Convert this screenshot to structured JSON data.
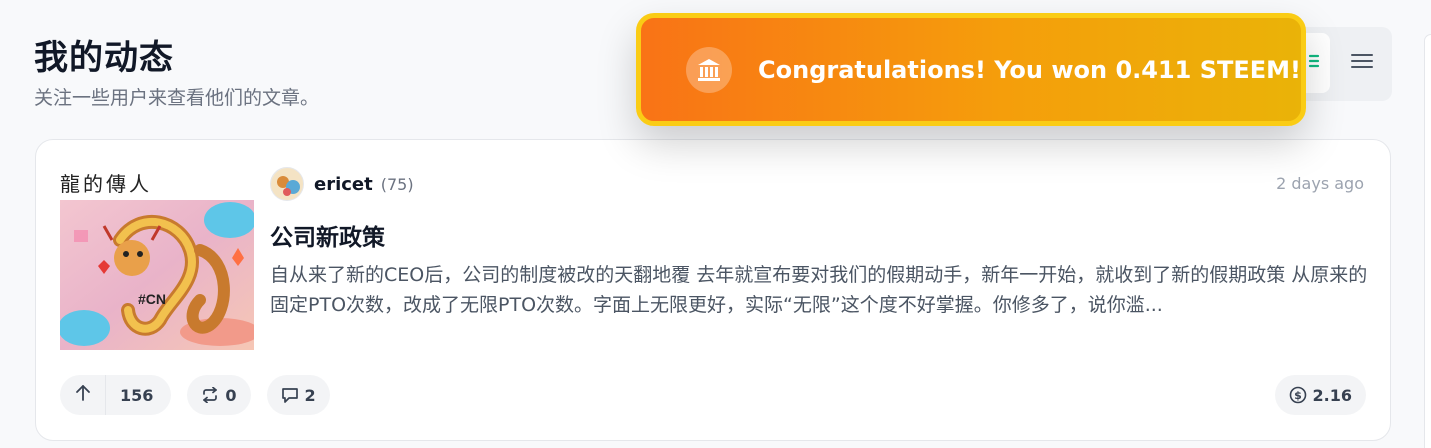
{
  "header": {
    "title": "我的动态",
    "subtitle": "关注一些用户来查看他们的文章。"
  },
  "view_toggle": {
    "list_icon": "list-icon",
    "compact_icon": "menu-lines-icon"
  },
  "toast": {
    "icon": "bank-icon",
    "message": "Congratulations! You won 0.411 STEEM!"
  },
  "post": {
    "thumbnail_caption": "龍的傳人",
    "author": {
      "name": "ericet",
      "reputation": "(75)"
    },
    "time": "2 days ago",
    "title": "公司新政策",
    "excerpt": "自从来了新的CEO后，公司的制度被改的天翻地覆 去年就宣布要对我们的假期动手，新年一开始，就收到了新的假期政策 从原来的固定PTO次数，改成了无限PTO次数。字面上无限更好，实际“无限”这个度不好掌握。你修多了，说你滥...",
    "actions": {
      "upvotes": "156",
      "reblogs": "0",
      "comments": "2",
      "payout": "2.16"
    }
  },
  "colors": {
    "toast_start": "#f97316",
    "toast_end": "#eab308",
    "toast_border": "#facc15",
    "accent_green": "#10b981"
  }
}
